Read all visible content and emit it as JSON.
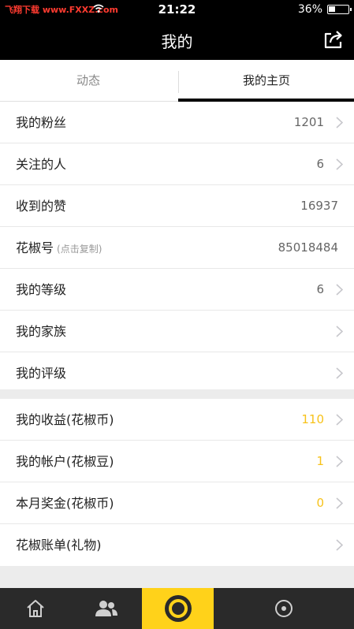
{
  "status_bar": {
    "carrier": "飞翔下载 www.FXXZ.com",
    "time": "21:22",
    "battery": "36%"
  },
  "nav": {
    "title": "我的",
    "share_icon": "share-icon"
  },
  "tabs": [
    {
      "label": "动态",
      "active": false
    },
    {
      "label": "我的主页",
      "active": true
    }
  ],
  "group1": [
    {
      "label": "我的粉丝",
      "value": "1201",
      "chevron": true
    },
    {
      "label": "关注的人",
      "value": "6",
      "chevron": true
    },
    {
      "label": "收到的赞",
      "value": "16937",
      "chevron": false
    },
    {
      "label": "花椒号",
      "sub": "(点击复制)",
      "value": "85018484",
      "chevron": false
    },
    {
      "label": "我的等级",
      "value": "6",
      "chevron": true
    },
    {
      "label": "我的家族",
      "value": "",
      "chevron": true
    },
    {
      "label": "我的评级",
      "value": "",
      "chevron": true
    }
  ],
  "group2": [
    {
      "label": "我的收益(花椒币)",
      "value": "110",
      "chevron": true
    },
    {
      "label": "我的帐户(花椒豆)",
      "value": "1",
      "chevron": true
    },
    {
      "label": "本月奖金(花椒币)",
      "value": "0",
      "chevron": true
    },
    {
      "label": "花椒账单(礼物)",
      "value": "",
      "chevron": true
    }
  ],
  "colors": {
    "accent_yellow": "#ffd21a",
    "value_yellow": "#f7c21a",
    "nav_black": "#000000"
  },
  "bottom_bar": {
    "items": [
      "home-icon",
      "people-icon",
      "live-camera-icon",
      "more-icon"
    ]
  }
}
